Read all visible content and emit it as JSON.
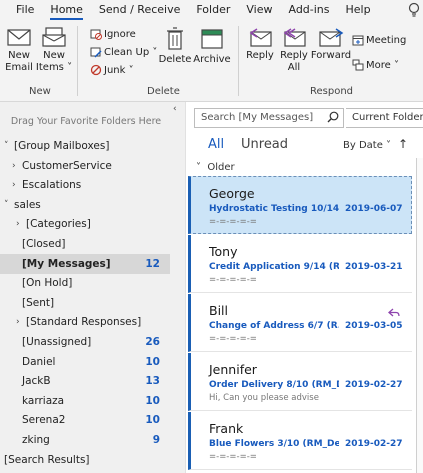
{
  "menubar": {
    "tabs": [
      "File",
      "Home",
      "Send / Receive",
      "Folder",
      "View",
      "Add-ins",
      "Help"
    ],
    "active": "Home"
  },
  "ribbon": {
    "new_email": "New\nEmail",
    "new_items": "New\nItems ˅",
    "ignore": "Ignore",
    "clean_up": "Clean Up ˅",
    "junk": "Junk ˅",
    "delete": "Delete",
    "archive": "Archive",
    "reply": "Reply",
    "reply_all": "Reply\nAll",
    "forward": "Forward",
    "meeting": "Meeting",
    "more": "More ˅",
    "group_new": "New",
    "group_delete": "Delete",
    "group_respond": "Respond"
  },
  "folderpane": {
    "hint": "Drag Your Favorite Folders Here",
    "folders": [
      {
        "name": "[Group Mailboxes]",
        "caret": "˅",
        "count": ""
      },
      {
        "name": "CustomerService",
        "caret": "›",
        "count": ""
      },
      {
        "name": "Escalations",
        "caret": "›",
        "count": ""
      },
      {
        "name": "sales",
        "caret": "˅",
        "count": ""
      },
      {
        "name": "[Categories]",
        "caret": "›",
        "count": ""
      },
      {
        "name": "[Closed]",
        "caret": "",
        "count": ""
      },
      {
        "name": "[My Messages]",
        "caret": "",
        "count": "12"
      },
      {
        "name": "[On Hold]",
        "caret": "",
        "count": ""
      },
      {
        "name": "[Sent]",
        "caret": "",
        "count": ""
      },
      {
        "name": "[Standard Responses]",
        "caret": "›",
        "count": ""
      },
      {
        "name": "[Unassigned]",
        "caret": "",
        "count": "26"
      },
      {
        "name": "Daniel",
        "caret": "",
        "count": "10"
      },
      {
        "name": "JackB",
        "caret": "",
        "count": "13"
      },
      {
        "name": "karriaza",
        "caret": "",
        "count": "10"
      },
      {
        "name": "Serena2",
        "caret": "",
        "count": "10"
      },
      {
        "name": "zking",
        "caret": "",
        "count": "9"
      },
      {
        "name": "[Search Results]",
        "caret": "",
        "count": ""
      }
    ]
  },
  "msglist": {
    "search_placeholder": "Search [My Messages]",
    "scope": "Current Folder",
    "tab_all": "All",
    "tab_unread": "Unread",
    "sort": "By Date ˅",
    "sort_arrow": "↑",
    "group": "Older",
    "messages": [
      {
        "sender": "George",
        "subject": "Hydrostatic Testing 10/14 (...",
        "date": "2019-06-07",
        "preview": "=-=-=-=-=",
        "replied": false
      },
      {
        "sender": "Tony",
        "subject": "Credit Application 9/14 (R...",
        "date": "2019-03-21",
        "preview": "=-=-=-=-=",
        "replied": false
      },
      {
        "sender": "Bill",
        "subject": "Change of Address 6/7 (R...",
        "date": "2019-03-05",
        "preview": "=-=-=-=-=",
        "replied": true
      },
      {
        "sender": "Jennifer",
        "subject": "Order Delivery 8/10 (RM_D...",
        "date": "2019-02-27",
        "preview": "Hi,  Can you please advise",
        "replied": false
      },
      {
        "sender": "Frank",
        "subject": "Blue Flowers 3/10 (RM_De...",
        "date": "2019-02-27",
        "preview": "=-=-=-=-=",
        "replied": false
      }
    ]
  },
  "colors": {
    "accent": "#185abd",
    "selected_msg": "#cce4f7",
    "selected_folder": "#d7d7d7"
  }
}
